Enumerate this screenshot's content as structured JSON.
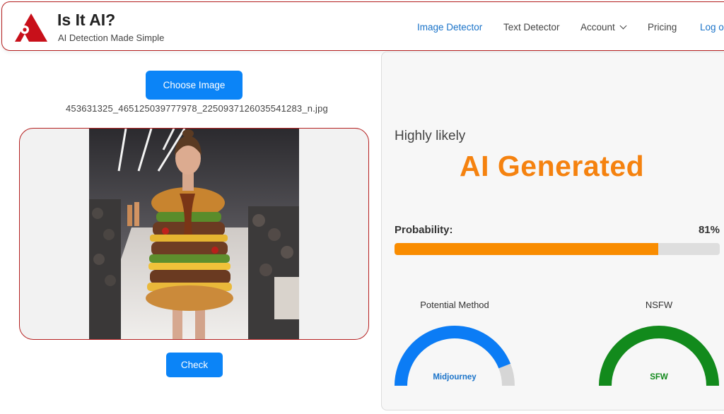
{
  "brand": {
    "title": "Is It AI?",
    "subtitle": "AI Detection Made Simple"
  },
  "nav": {
    "items": [
      {
        "label": "Image Detector",
        "active": true
      },
      {
        "label": "Text Detector"
      },
      {
        "label": "Account"
      },
      {
        "label": "Pricing"
      },
      {
        "label": "Log o"
      }
    ]
  },
  "upload": {
    "choose_label": "Choose Image",
    "filename": "453631325_465125039777978_2250937126035541283_n.jpg",
    "check_label": "Check"
  },
  "result": {
    "likelihood": "Highly likely",
    "verdict": "AI Generated",
    "probability_label": "Probability:",
    "probability_text": "81%",
    "probability": 0.81,
    "method_title": "Potential Method",
    "method_value": "Midjourney",
    "method_level": 0.88,
    "nsfw_title": "NSFW",
    "nsfw_value": "SFW",
    "nsfw_level": 1.0
  },
  "colors": {
    "accent": "#0b84f7",
    "verdict": "#f5820f",
    "probability_bar": "#f98c00",
    "method_gauge": "#0b7cf5",
    "nsfw_gauge": "#128a1c",
    "border_red": "#b52020"
  },
  "icons": {
    "logo": "red-triangle-eye-icon",
    "account_menu": "chevron-down-icon"
  }
}
